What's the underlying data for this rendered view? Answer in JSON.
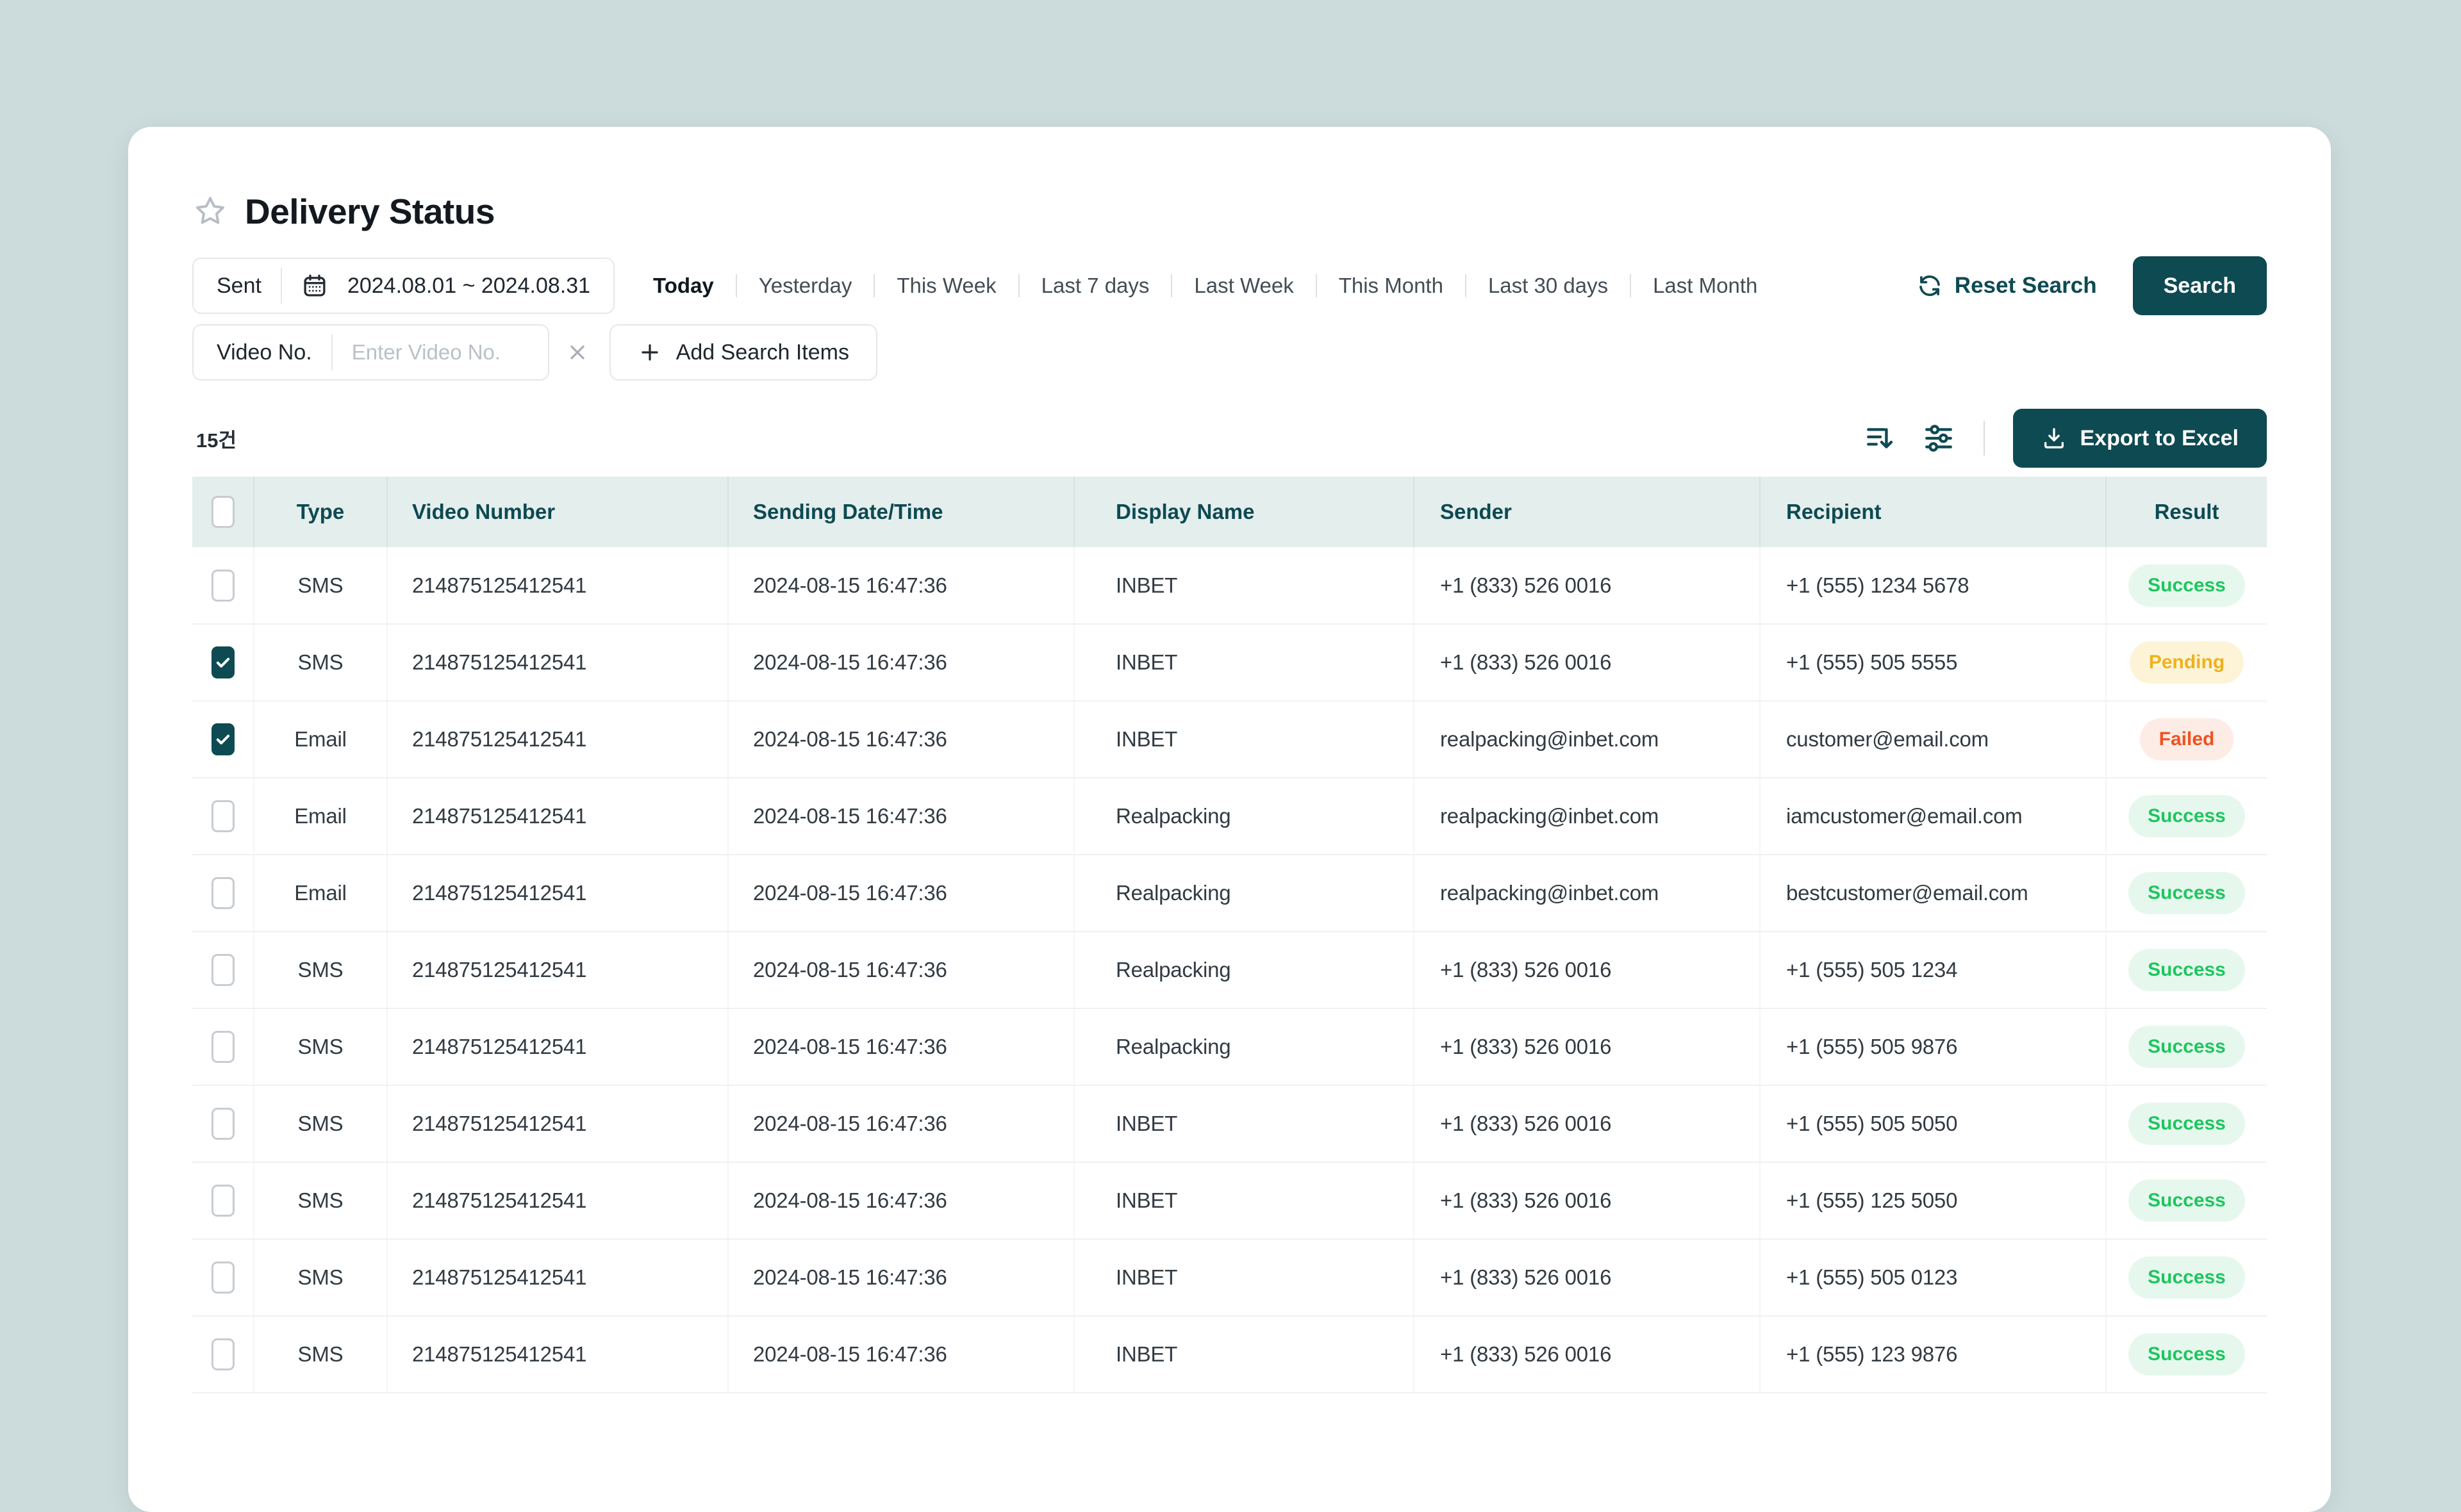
{
  "page": {
    "title": "Delivery Status",
    "count_label": "15건"
  },
  "colors": {
    "accent_teal": "#0e4a52",
    "page_background": "#ccdbdb",
    "header_row_background": "#e4eeed",
    "success_text": "#1fc55f",
    "success_background": "#e6f8ee",
    "pending_text": "#f0b11c",
    "pending_background": "#fdf4d8",
    "failed_text": "#f1511f",
    "failed_background": "#fdece5"
  },
  "icons": {
    "star": "outline-star",
    "calendar": "calendar-grid",
    "reset": "refresh-cycle-arrows",
    "remove": "x-cross",
    "add": "plus",
    "sort": "sort-descending-lines-arrow",
    "filter": "sliders",
    "export": "download-tray",
    "check": "checkmark"
  },
  "filters": {
    "status_field": {
      "label": "Sent",
      "date_range": "2024.08.01 ~ 2024.08.31"
    },
    "quick_ranges": [
      "Today",
      "Yesterday",
      "This Week",
      "Last 7 days",
      "Last Week",
      "This Month",
      "Last 30 days",
      "Last Month"
    ],
    "active_quick_range_index": 0,
    "reset_label": "Reset Search",
    "search_label": "Search",
    "video_field": {
      "label": "Video No.",
      "placeholder": "Enter Video No."
    },
    "add_item_label": "Add Search Items"
  },
  "toolbar": {
    "export_label": "Export to Excel"
  },
  "table": {
    "columns": [
      "Type",
      "Video Number",
      "Sending Date/Time",
      "Display Name",
      "Sender",
      "Recipient",
      "Result"
    ],
    "rows": [
      {
        "checked": false,
        "type": "SMS",
        "video_number": "214875125412541",
        "sent_at": "2024-08-15 16:47:36",
        "display_name": "INBET",
        "sender": "+1 (833) 526 0016",
        "recipient": "+1 (555) 1234 5678",
        "result": "Success"
      },
      {
        "checked": true,
        "type": "SMS",
        "video_number": "214875125412541",
        "sent_at": "2024-08-15 16:47:36",
        "display_name": "INBET",
        "sender": "+1 (833) 526 0016",
        "recipient": "+1 (555) 505 5555",
        "result": "Pending"
      },
      {
        "checked": true,
        "type": "Email",
        "video_number": "214875125412541",
        "sent_at": "2024-08-15 16:47:36",
        "display_name": "INBET",
        "sender": "realpacking@inbet.com",
        "recipient": "customer@email.com",
        "result": "Failed"
      },
      {
        "checked": false,
        "type": "Email",
        "video_number": "214875125412541",
        "sent_at": "2024-08-15 16:47:36",
        "display_name": "Realpacking",
        "sender": "realpacking@inbet.com",
        "recipient": "iamcustomer@email.com",
        "result": "Success"
      },
      {
        "checked": false,
        "type": "Email",
        "video_number": "214875125412541",
        "sent_at": "2024-08-15 16:47:36",
        "display_name": "Realpacking",
        "sender": "realpacking@inbet.com",
        "recipient": "bestcustomer@email.com",
        "result": "Success"
      },
      {
        "checked": false,
        "type": "SMS",
        "video_number": "214875125412541",
        "sent_at": "2024-08-15 16:47:36",
        "display_name": "Realpacking",
        "sender": "+1 (833) 526 0016",
        "recipient": "+1 (555) 505 1234",
        "result": "Success"
      },
      {
        "checked": false,
        "type": "SMS",
        "video_number": "214875125412541",
        "sent_at": "2024-08-15 16:47:36",
        "display_name": "Realpacking",
        "sender": "+1 (833) 526 0016",
        "recipient": "+1 (555) 505 9876",
        "result": "Success"
      },
      {
        "checked": false,
        "type": "SMS",
        "video_number": "214875125412541",
        "sent_at": "2024-08-15 16:47:36",
        "display_name": "INBET",
        "sender": "+1 (833) 526 0016",
        "recipient": "+1 (555) 505 5050",
        "result": "Success"
      },
      {
        "checked": false,
        "type": "SMS",
        "video_number": "214875125412541",
        "sent_at": "2024-08-15 16:47:36",
        "display_name": "INBET",
        "sender": "+1 (833) 526 0016",
        "recipient": "+1 (555) 125 5050",
        "result": "Success"
      },
      {
        "checked": false,
        "type": "SMS",
        "video_number": "214875125412541",
        "sent_at": "2024-08-15 16:47:36",
        "display_name": "INBET",
        "sender": "+1 (833) 526 0016",
        "recipient": "+1 (555) 505 0123",
        "result": "Success"
      },
      {
        "checked": false,
        "type": "SMS",
        "video_number": "214875125412541",
        "sent_at": "2024-08-15 16:47:36",
        "display_name": "INBET",
        "sender": "+1 (833) 526 0016",
        "recipient": "+1 (555) 123 9876",
        "result": "Success"
      }
    ]
  }
}
